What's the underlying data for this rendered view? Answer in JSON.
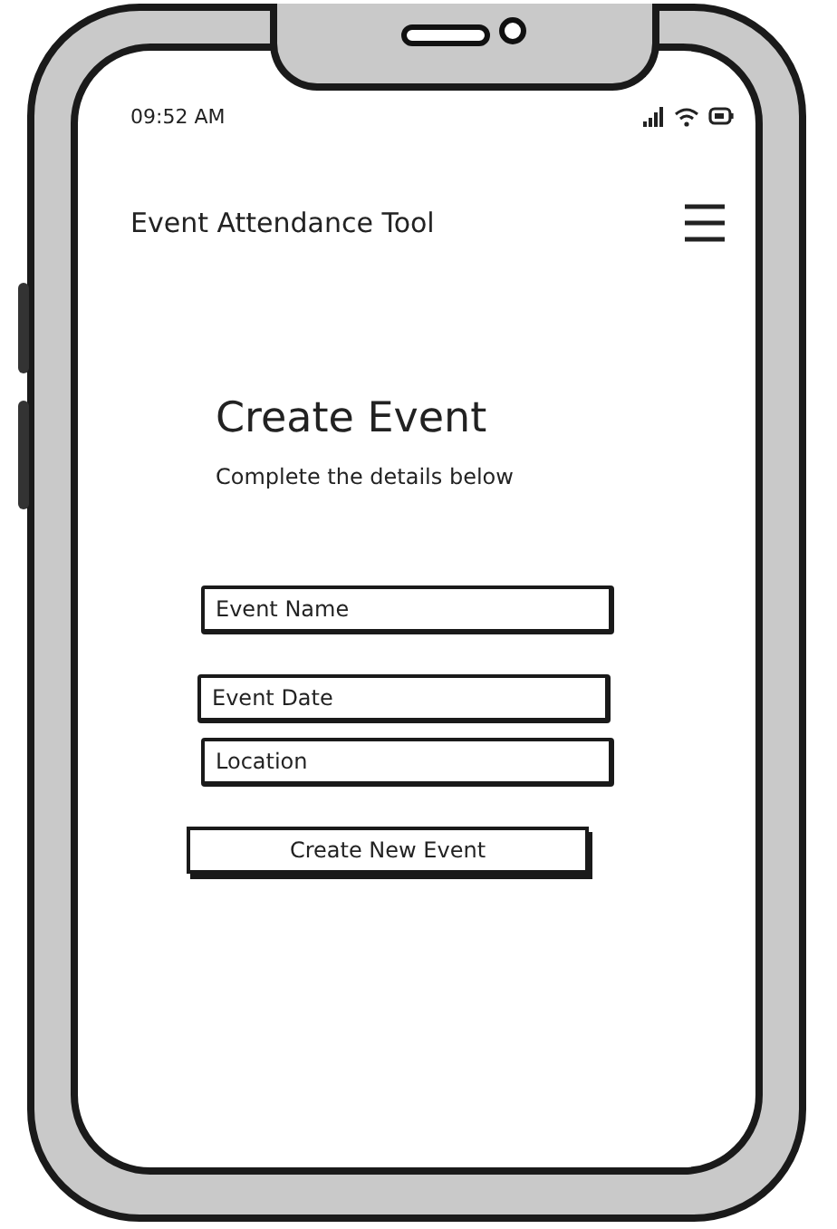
{
  "status_bar": {
    "time": "09:52 AM"
  },
  "header": {
    "title": "Event Attendance Tool"
  },
  "form": {
    "title": "Create Event",
    "subtitle": "Complete the details below",
    "fields": [
      {
        "placeholder": "Event Name"
      },
      {
        "placeholder": "Event Date"
      },
      {
        "placeholder": "Location"
      }
    ],
    "button": "Create New Event"
  }
}
